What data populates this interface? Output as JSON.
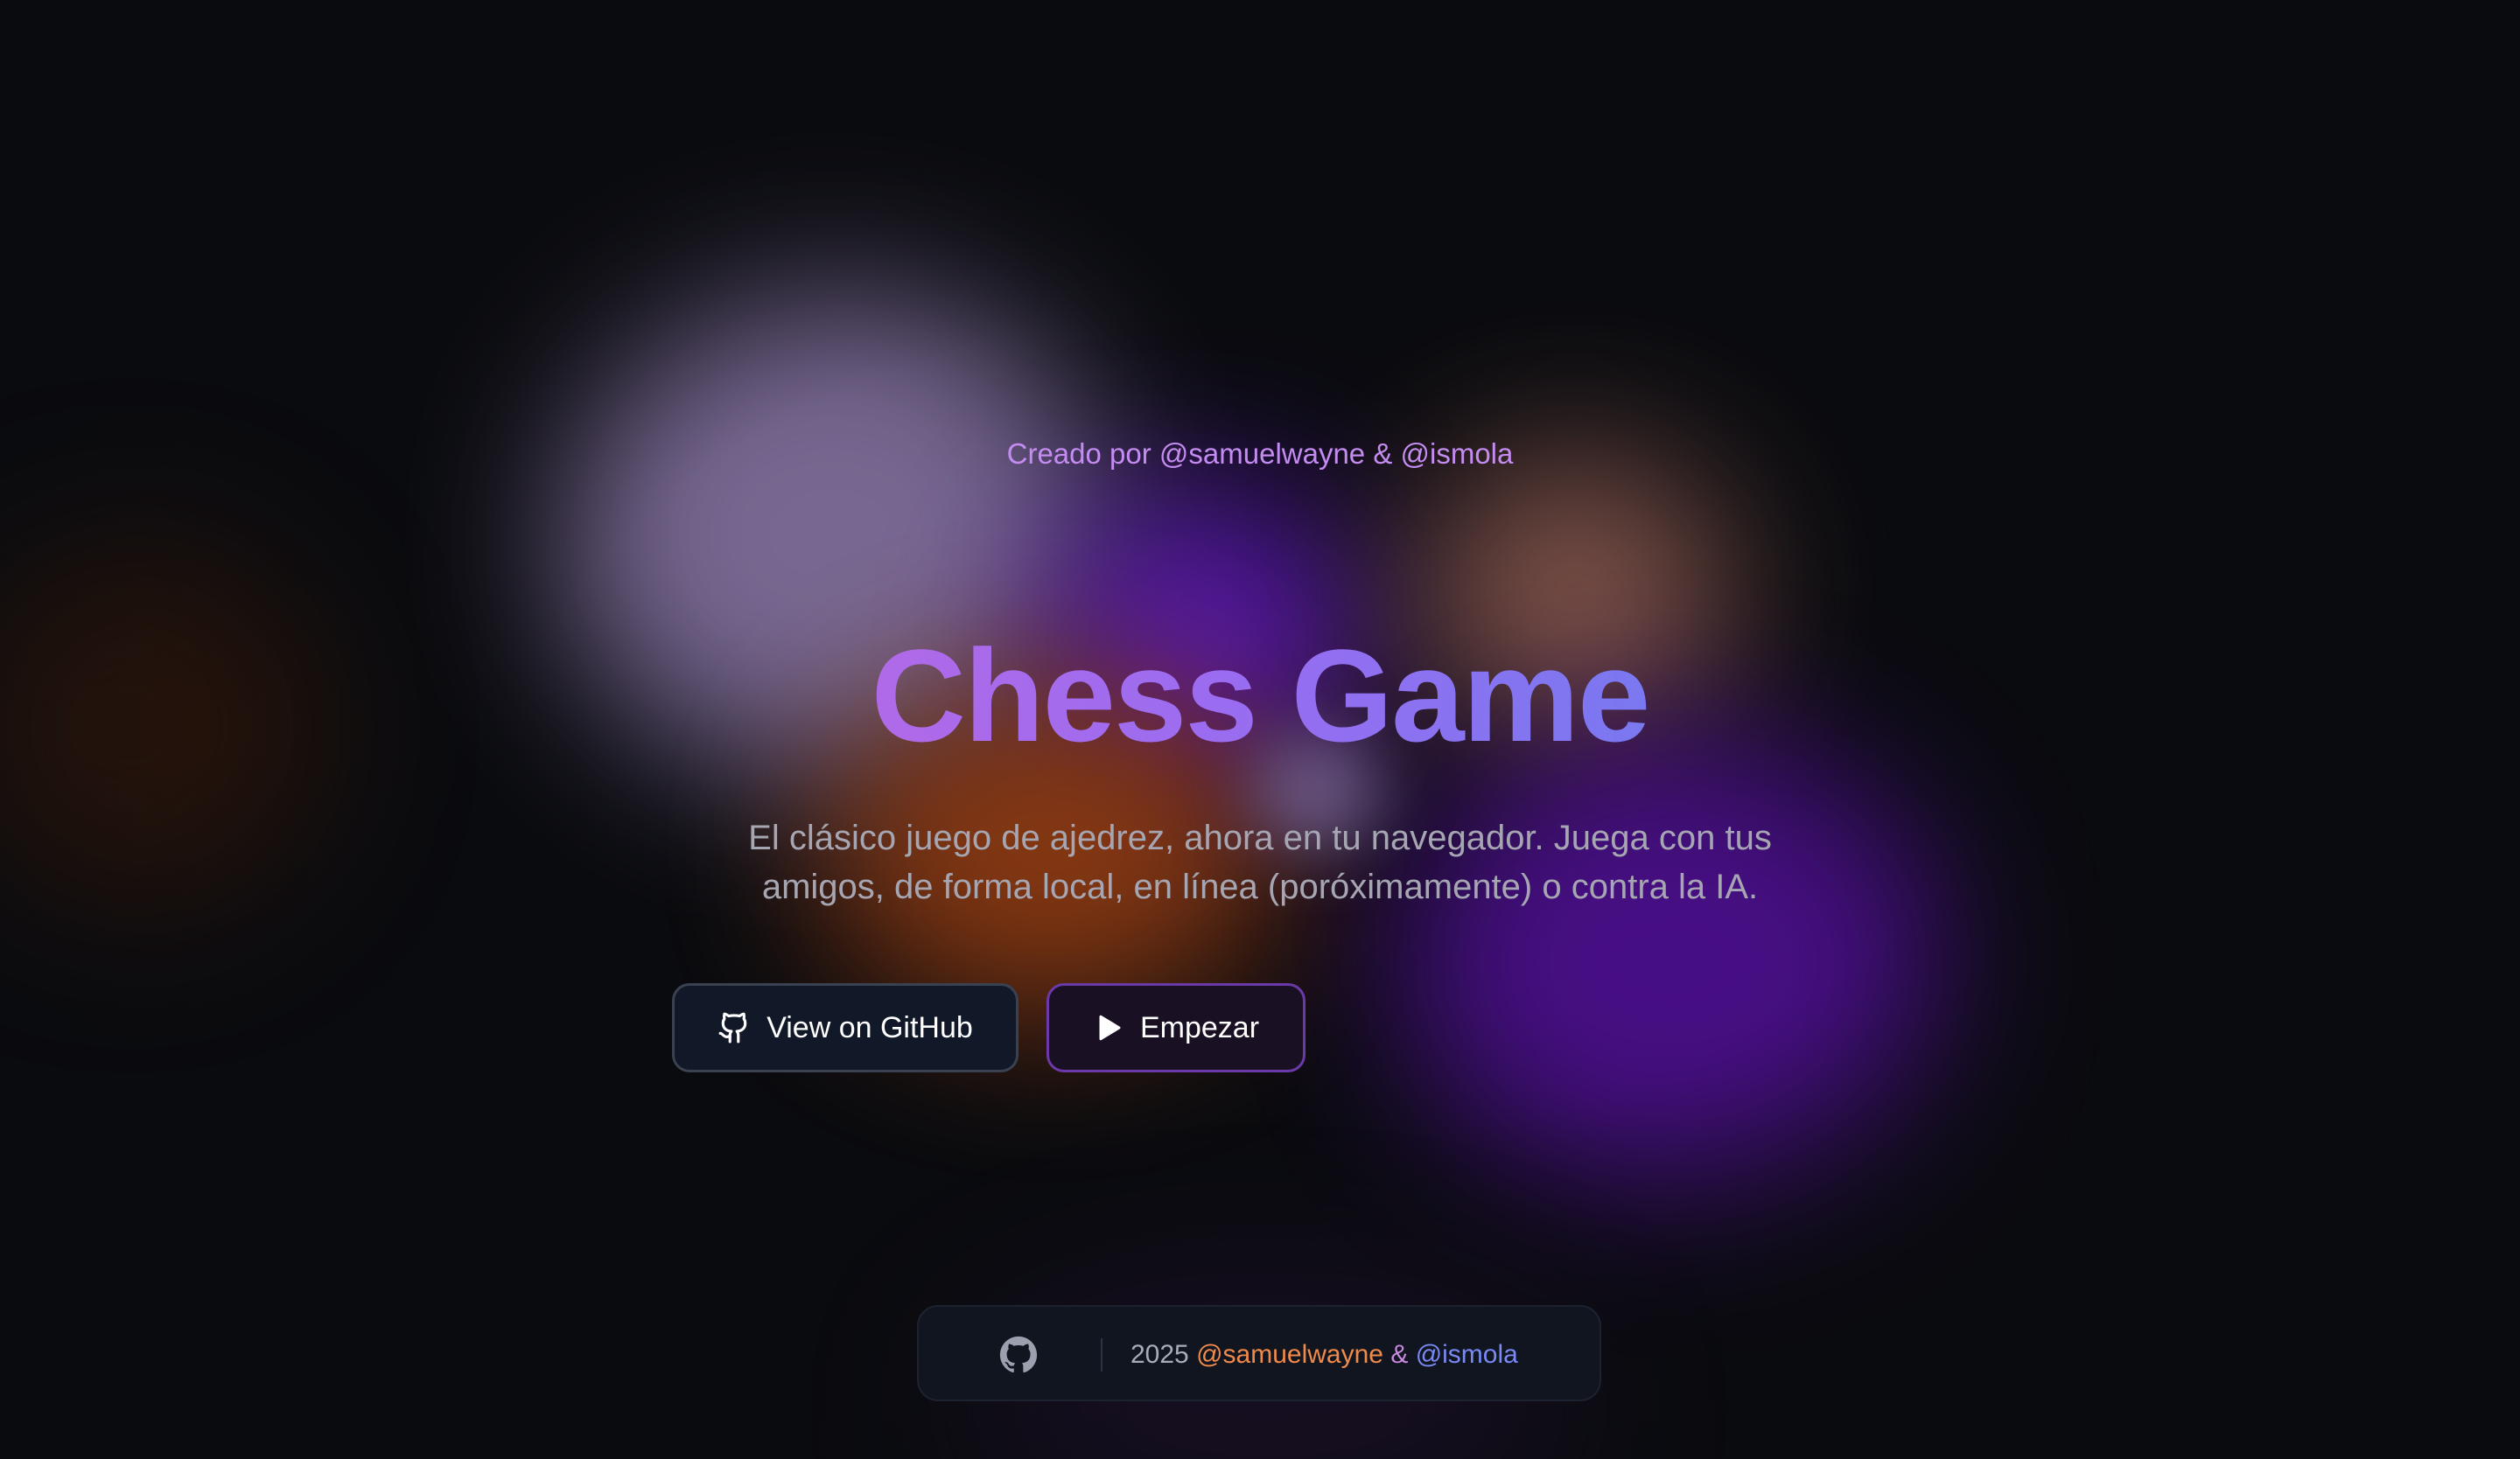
{
  "hero": {
    "credit": "Creado por @samuelwayne & @ismola",
    "title": "Chess Game",
    "subtitle": "El clásico juego de ajedrez, ahora en tu navegador. Juega con tus amigos, de forma local, en línea (poróximamente) o contra la IA."
  },
  "buttons": {
    "github_label": "View on GitHub",
    "github_icon": "github-icon",
    "start_label": "Empezar",
    "start_icon": "play-icon"
  },
  "footer": {
    "icon": "github-icon",
    "year": "2025",
    "handle1": "@samuelwayne",
    "amp": "&",
    "handle2": "@ismola"
  },
  "colors": {
    "background": "#0a0b0f",
    "accent_purple": "#9a6cf0",
    "credit": "#c48cf0",
    "handle_orange": "#f08a4a",
    "handle_blue": "#7a8af5"
  }
}
